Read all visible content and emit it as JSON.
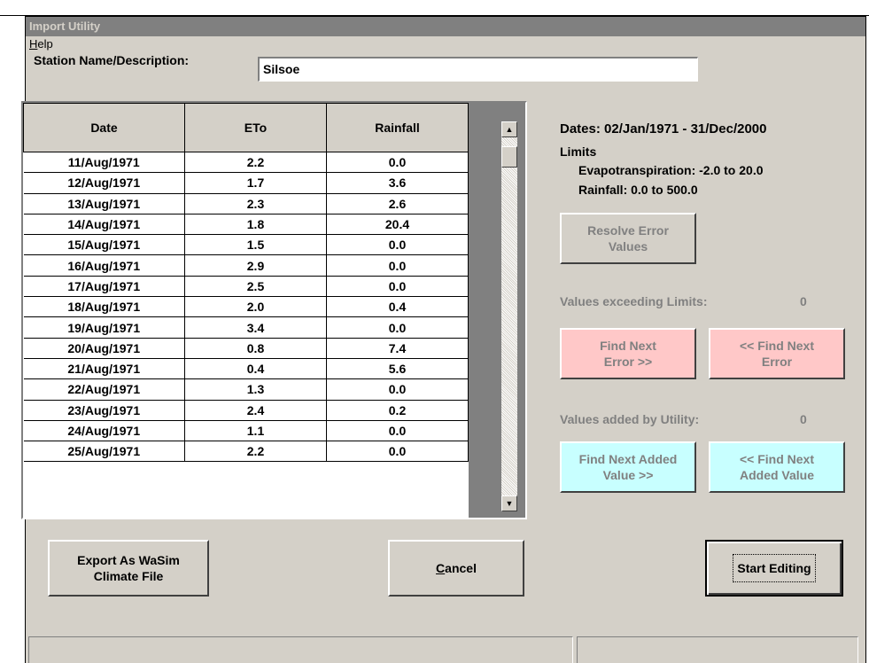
{
  "window": {
    "title": "Import Utility"
  },
  "menu": {
    "help_label": "Help"
  },
  "station": {
    "label": "Station Name/Description:",
    "value": "Silsoe"
  },
  "grid": {
    "headers": [
      "Date",
      "ETo",
      "Rainfall"
    ],
    "rows": [
      [
        "11/Aug/1971",
        "2.2",
        "0.0"
      ],
      [
        "12/Aug/1971",
        "1.7",
        "3.6"
      ],
      [
        "13/Aug/1971",
        "2.3",
        "2.6"
      ],
      [
        "14/Aug/1971",
        "1.8",
        "20.4"
      ],
      [
        "15/Aug/1971",
        "1.5",
        "0.0"
      ],
      [
        "16/Aug/1971",
        "2.9",
        "0.0"
      ],
      [
        "17/Aug/1971",
        "2.5",
        "0.0"
      ],
      [
        "18/Aug/1971",
        "2.0",
        "0.4"
      ],
      [
        "19/Aug/1971",
        "3.4",
        "0.0"
      ],
      [
        "20/Aug/1971",
        "0.8",
        "7.4"
      ],
      [
        "21/Aug/1971",
        "0.4",
        "5.6"
      ],
      [
        "22/Aug/1971",
        "1.3",
        "0.0"
      ],
      [
        "23/Aug/1971",
        "2.4",
        "0.2"
      ],
      [
        "24/Aug/1971",
        "1.1",
        "0.0"
      ],
      [
        "25/Aug/1971",
        "2.2",
        "0.0"
      ]
    ]
  },
  "info": {
    "dates": "Dates: 02/Jan/1971 - 31/Dec/2000",
    "limits_label": "Limits",
    "evap_limit": "Evapotranspiration: -2.0 to 20.0",
    "rain_limit": "Rainfall: 0.0 to 500.0",
    "exceeding_label": "Values exceeding Limits:",
    "exceeding_count": "0",
    "added_label": "Values added by Utility:",
    "added_count": "0"
  },
  "buttons": {
    "resolve": "Resolve Error Values",
    "find_next_error": "Find Next Error >>",
    "find_prev_error": "<< Find Next Error",
    "find_next_added": "Find Next Added Value >>",
    "find_prev_added": "<< Find Next Added Value",
    "export": "Export As WaSim Climate File",
    "cancel": "Cancel",
    "start_editing": "Start Editing"
  },
  "colors": {
    "error_button": "#ffc8c8",
    "added_button": "#c8ffff",
    "title_bar": "#808080"
  }
}
